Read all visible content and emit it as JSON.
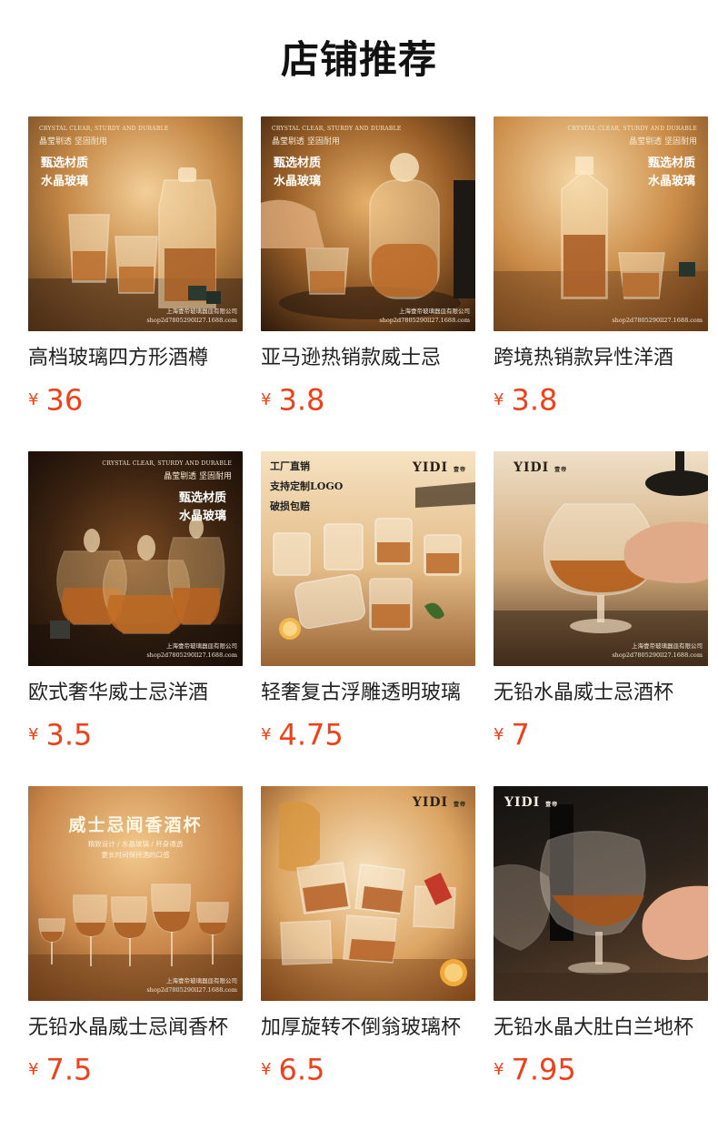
{
  "page": {
    "title": "店铺推荐"
  },
  "products": [
    {
      "title": "高档玻璃四方形酒樽",
      "currency": "¥",
      "price": "36",
      "image": {
        "tagline_en": "CRYSTAL CLEAR, STURDY AND DURABLE",
        "tagline_cn": "晶莹剔透 坚固耐用",
        "headline_1": "甄选材质",
        "headline_2": "水晶玻璃",
        "shop_1": "上海壹帝玻璃器皿有限公司",
        "shop_2": "shop2d7805290ll27.1688.com",
        "colors": [
          "#b97a3c",
          "#e9c089",
          "#4a2c14"
        ]
      }
    },
    {
      "title": "亚马逊热销款威士忌",
      "currency": "¥",
      "price": "3.8",
      "image": {
        "tagline_en": "CRYSTAL CLEAR, STURDY AND DURABLE",
        "tagline_cn": "晶莹剔透 坚固耐用",
        "headline_1": "甄选材质",
        "headline_2": "水晶玻璃",
        "shop_1": "上海壹帝玻璃器皿有限公司",
        "shop_2": "shop2d7805290ll27.1688.com",
        "colors": [
          "#8a5526",
          "#d9a35e",
          "#2b1a0c"
        ]
      }
    },
    {
      "title": "跨境热销款异性洋酒",
      "currency": "¥",
      "price": "3.8",
      "image": {
        "tagline_en": "CRYSTAL CLEAR, STURDY AND DURABLE",
        "tagline_cn": "晶莹剔透 坚固耐用",
        "headline_1": "甄选材质",
        "headline_2": "水晶玻璃",
        "shop_1": "",
        "shop_2": "shop2d7805290ll27.1688.com",
        "colors": [
          "#c98b49",
          "#f0c98e",
          "#5a3414"
        ]
      }
    },
    {
      "title": "欧式奢华威士忌洋酒",
      "currency": "¥",
      "price": "3.5",
      "image": {
        "tagline_en": "CRYSTAL CLEAR, STURDY AND DURABLE",
        "tagline_cn": "晶莹剔透 坚固耐用",
        "headline_1": "甄选材质",
        "headline_2": "水晶玻璃",
        "shop_1": "上海壹帝玻璃器皿有限公司",
        "shop_2": "shop2d7805290ll27.1688.com",
        "colors": [
          "#3a2414",
          "#8a5a30",
          "#c4823e"
        ]
      }
    },
    {
      "title": "轻奢复古浮雕透明玻璃",
      "currency": "¥",
      "price": "4.75",
      "image": {
        "brand": "YIDI",
        "brand_small": "壹帝",
        "feature_1": "工厂直销",
        "feature_2": "支持定制LOGO",
        "feature_3": "破损包赔",
        "colors": [
          "#f1d9b4",
          "#d8a870",
          "#7a4a22"
        ]
      }
    },
    {
      "title": "无铅水晶威士忌酒杯",
      "currency": "¥",
      "price": "7",
      "image": {
        "brand": "YIDI",
        "brand_small": "壹帝",
        "shop_1": "上海壹帝玻璃器皿有限公司",
        "shop_2": "shop2d7805290ll27.1688.com",
        "colors": [
          "#e4c9a2",
          "#b88b5c",
          "#3b2818"
        ]
      }
    },
    {
      "title": "无铅水晶威士忌闻香杯",
      "currency": "¥",
      "price": "7.5",
      "image": {
        "hero": "威士忌闻香酒杯",
        "tag_1": "精致设计 / 水晶玻璃 / 杯身通透",
        "tag_2": "更长时间保持酒的口感",
        "shop_1": "上海壹帝玻璃器皿有限公司",
        "shop_2": "shop2d7805290ll27.1688.com",
        "colors": [
          "#c78546",
          "#ecbb7c",
          "#6a3c18"
        ]
      }
    },
    {
      "title": "加厚旋转不倒翁玻璃杯",
      "currency": "¥",
      "price": "6.5",
      "image": {
        "brand": "YIDI",
        "brand_small": "壹帝",
        "colors": [
          "#f3ddbc",
          "#d59a55",
          "#7c4318"
        ]
      }
    },
    {
      "title": "无铅水晶大肚白兰地杯",
      "currency": "¥",
      "price": "7.95",
      "image": {
        "brand": "YIDI",
        "brand_small": "壹帝",
        "colors": [
          "#1d1a18",
          "#5a4330",
          "#c18a55"
        ]
      }
    }
  ]
}
